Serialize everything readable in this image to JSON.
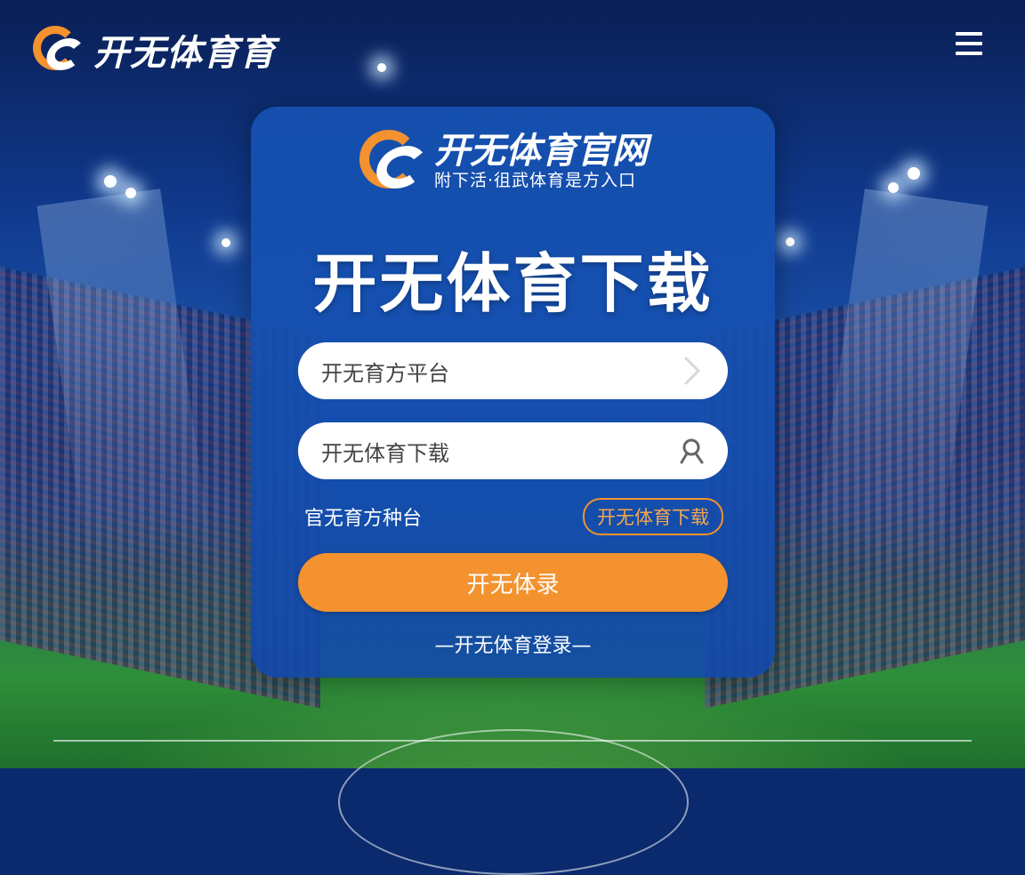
{
  "header": {
    "brand": "开无体育育",
    "menu_icon": "hamburger-menu-icon"
  },
  "card": {
    "brand_title": "开无体育官网",
    "brand_subtitle": "附下活·徂武体育是方入口",
    "headline": "开无体育下载",
    "field1": {
      "value": "开无育方平台",
      "icon": "chevron-right-icon"
    },
    "field2": {
      "value": "开无体育下载",
      "icon": "search-icon"
    },
    "link_left": "官无育方种台",
    "outline_button": "开无体育下载",
    "primary_button": "开无体录",
    "footer": "—开无体育登录—"
  },
  "colors": {
    "accent": "#f3922e",
    "card_blue": "#1652b2",
    "text_white": "#ffffff"
  }
}
